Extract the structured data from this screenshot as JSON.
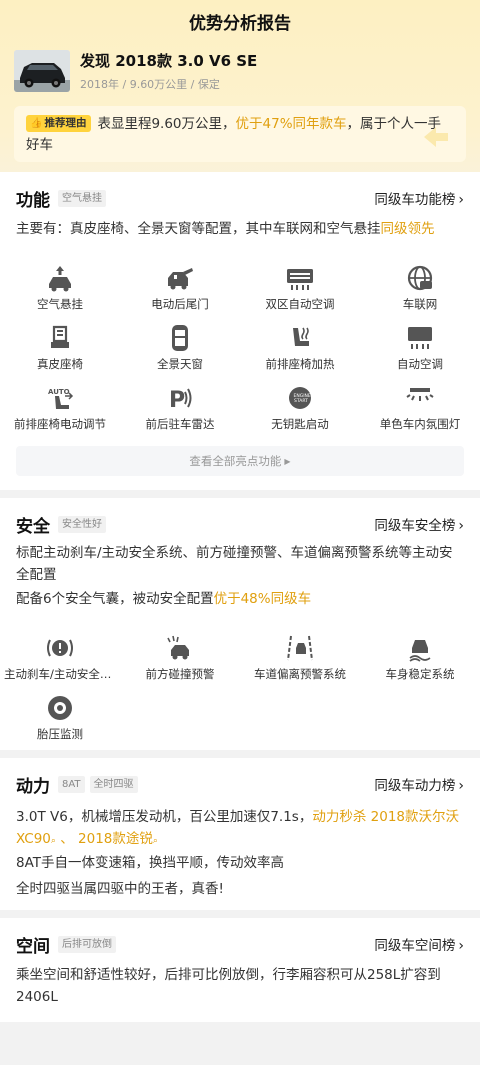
{
  "header": {
    "title": "优势分析报告"
  },
  "car": {
    "name": "发现 2018款 3.0 V6 SE",
    "meta": "2018年 / 9.60万公里 / 保定"
  },
  "reason": {
    "tag": "推荐理由",
    "text_1": "表显里程9.60万公里，",
    "highlight": "优于47%同年款车",
    "text_2": "，属于个人一手好车"
  },
  "function": {
    "title": "功能",
    "badge": "空气悬挂",
    "link": "同级车功能榜",
    "desc_1": "主要有：真皮座椅、全景天窗等配置，其中车联网和空气悬挂",
    "desc_hl": "同级领先",
    "features": [
      {
        "label": "空气悬挂",
        "icon": "air-suspension-icon"
      },
      {
        "label": "电动后尾门",
        "icon": "power-tailgate-icon"
      },
      {
        "label": "双区自动空调",
        "icon": "dual-zone-ac-icon"
      },
      {
        "label": "车联网",
        "icon": "connected-car-icon"
      },
      {
        "label": "真皮座椅",
        "icon": "leather-seat-icon"
      },
      {
        "label": "全景天窗",
        "icon": "panoramic-sunroof-icon"
      },
      {
        "label": "前排座椅加热",
        "icon": "seat-heating-icon"
      },
      {
        "label": "自动空调",
        "icon": "auto-ac-icon"
      },
      {
        "label": "前排座椅电动调节",
        "icon": "power-seat-icon"
      },
      {
        "label": "前后驻车雷达",
        "icon": "parking-radar-icon"
      },
      {
        "label": "无钥匙启动",
        "icon": "keyless-start-icon"
      },
      {
        "label": "单色车内氛围灯",
        "icon": "ambient-light-icon"
      }
    ],
    "more": "查看全部亮点功能"
  },
  "safety": {
    "title": "安全",
    "badge": "安全性好",
    "link": "同级车安全榜",
    "desc_1": "标配主动刹车/主动安全系统、前方碰撞预警、车道偏离预警系统等主动安全配置",
    "desc_2": "配备6个安全气囊，被动安全配置",
    "desc_2_hl": "优于48%同级车",
    "features": [
      {
        "label": "主动刹车/主动安全系统",
        "icon": "active-brake-icon"
      },
      {
        "label": "前方碰撞预警",
        "icon": "collision-warning-icon"
      },
      {
        "label": "车道偏离预警系统",
        "icon": "lane-departure-icon"
      },
      {
        "label": "车身稳定系统",
        "icon": "stability-control-icon"
      },
      {
        "label": "胎压监测",
        "icon": "tire-pressure-icon"
      }
    ]
  },
  "power": {
    "title": "动力",
    "badge_1": "8AT",
    "badge_2": "全时四驱",
    "link": "同级车动力榜",
    "line_1a": "3.0T V6，机械增压发动机，百公里加速仅7.1s，",
    "line_1_hl": "动力秒杀",
    "rival_1_a": "2018款沃尔沃",
    "rival_1_b": "XC90",
    "sep": "、",
    "rival_2": "2018款途锐",
    "line_2": "8AT手自一体变速箱，换挡平顺，传动效率高",
    "line_3": "全时四驱当属四驱中的王者，真香!"
  },
  "space": {
    "title": "空间",
    "badge": "后排可放倒",
    "link": "同级车空间榜",
    "desc": "乘坐空间和舒适性较好，后排可比例放倒，行李厢容积可从258L扩容到2406L"
  },
  "colors": {
    "accent": "#e0a010",
    "tag": "#ffd33d",
    "header_bg": "#fdf0c2"
  }
}
